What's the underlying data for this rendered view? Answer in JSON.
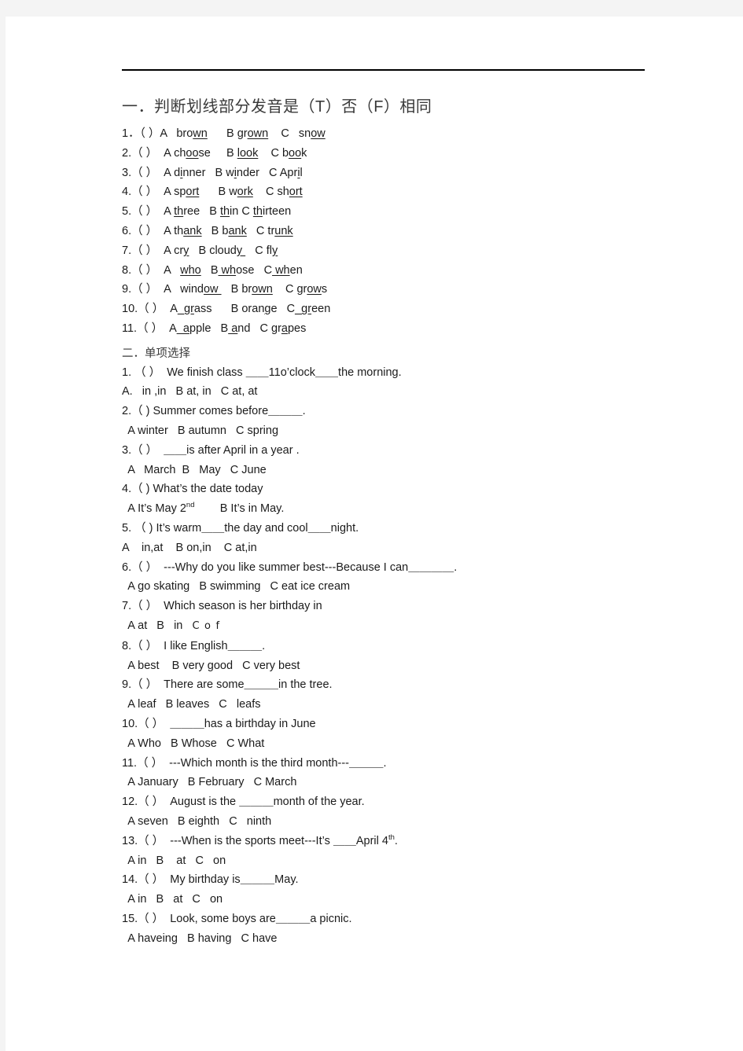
{
  "document": {
    "rule_present": true,
    "text_color": "#1b1b1b",
    "heading_color": "#3a3a3a",
    "page_background": "#ffffff",
    "canvas_background": "#f4f4f4"
  },
  "section_one": {
    "heading": "一．判断划线部分发音是（T）否（F）相同",
    "items": [
      {
        "num": "1．",
        "bracket": "（ ）",
        "parts": [
          {
            "pre": "A   bro",
            "u": "wn",
            "post": ""
          },
          {
            "pre": "      B gr",
            "u": "own",
            "post": ""
          },
          {
            "pre": "    C   sn",
            "u": "ow",
            "post": ""
          }
        ]
      },
      {
        "num": "2.",
        "bracket": "（ ）",
        "parts": [
          {
            "pre": "  A ch",
            "u": "oo",
            "post": "se"
          },
          {
            "pre": "     B ",
            "u": "look",
            "post": ""
          },
          {
            "pre": "    C b",
            "u": "oo",
            "post": "k"
          }
        ]
      },
      {
        "num": "3.",
        "bracket": "（ ）",
        "parts": [
          {
            "pre": "  A d",
            "u": "i",
            "post": "nner"
          },
          {
            "pre": "   B w",
            "u": "i",
            "post": "nder"
          },
          {
            "pre": "   C Apr",
            "u": "i",
            "post": "l"
          }
        ]
      },
      {
        "num": "4.",
        "bracket": "（ ）",
        "parts": [
          {
            "pre": "  A sp",
            "u": "ort",
            "post": ""
          },
          {
            "pre": "      B w",
            "u": "ork",
            "post": ""
          },
          {
            "pre": "    C sh",
            "u": "ort",
            "post": ""
          }
        ]
      },
      {
        "num": "5.",
        "bracket": "（ ）",
        "parts": [
          {
            "pre": "  A ",
            "u": "th",
            "post": "ree"
          },
          {
            "pre": "   B ",
            "u": "th",
            "post": "in"
          },
          {
            "pre": " C ",
            "u": "th",
            "post": "irteen"
          }
        ]
      },
      {
        "num": "6.",
        "bracket": "（ ）",
        "parts": [
          {
            "pre": "  A th",
            "u": "ank",
            "post": ""
          },
          {
            "pre": "   B b",
            "u": "ank",
            "post": ""
          },
          {
            "pre": "   C tr",
            "u": "unk",
            "post": ""
          }
        ]
      },
      {
        "num": "7.",
        "bracket": "（ ）",
        "parts": [
          {
            "pre": "  A cr",
            "u": "y",
            "post": ""
          },
          {
            "pre": "   B cloud",
            "u": "y ",
            "post": ""
          },
          {
            "pre": "   C fl",
            "u": "y",
            "post": ""
          }
        ]
      },
      {
        "num": "8.",
        "bracket": "（ ）",
        "parts": [
          {
            "pre": "  A   ",
            "u": "who",
            "post": ""
          },
          {
            "pre": "   B",
            "u": " wh",
            "post": "ose"
          },
          {
            "pre": "   C",
            "u": " wh",
            "post": "en"
          }
        ]
      },
      {
        "num": "9.",
        "bracket": "（ ）",
        "parts": [
          {
            "pre": "  A   wind",
            "u": "ow ",
            "post": ""
          },
          {
            "pre": "   B br",
            "u": "own",
            "post": ""
          },
          {
            "pre": "    C gr",
            "u": "ow",
            "post": "s"
          }
        ]
      },
      {
        "num": "10.",
        "bracket": "（ ）",
        "parts": [
          {
            "pre": "  A",
            "u": "_gr",
            "post": "ass"
          },
          {
            "pre": "      B oran",
            "u": "g",
            "post": "e"
          },
          {
            "pre": "   C",
            "u": "_gr",
            "post": "een"
          }
        ]
      },
      {
        "num": "11.",
        "bracket": "（ ）",
        "parts": [
          {
            "pre": "  A",
            "u": "_a",
            "post": "pple"
          },
          {
            "pre": "   B",
            "u": " a",
            "post": "nd"
          },
          {
            "pre": "   C gr",
            "u": "a",
            "post": "pes"
          }
        ]
      }
    ]
  },
  "section_two": {
    "heading": "二．单项选择",
    "questions": [
      {
        "stem": "1. （ ）  We finish class ＿＿11o’clock＿＿the morning.",
        "options": "A.   in ,in   B at, in   C at, at"
      },
      {
        "stem": "2.（ ) Summer comes before＿＿＿.",
        "options": " A winter   B autumn   C spring"
      },
      {
        "stem": "3.（ ）  ＿＿is after April in a year .",
        "options": " A   March  B   May   C June"
      },
      {
        "stem": "4.（ ) What’s the date today",
        "options": " A It’s May 2",
        "options_sup": "nd",
        "options_tail": "        B It’s in May."
      },
      {
        "stem": "5. （ ) It’s warm＿＿the day and cool＿＿night.",
        "options": "A    in,at    B on,in    C at,in"
      },
      {
        "stem": "6.（ ）  ---Why do you like summer best---Because I can＿＿＿＿.",
        "options": " A go skating   B swimming   C eat ice cream"
      },
      {
        "stem": "7.（ ）  Which season is her birthday in",
        "options": " A at   B   in   ",
        "options_odd": "C o f"
      },
      {
        "stem": "8.（ ）  I like English＿＿＿.",
        "options": " A best    B very good   C very best"
      },
      {
        "stem": "9.（ ）  There are some＿＿＿in the tree.",
        "options": " A leaf   B leaves   C   leafs"
      },
      {
        "stem": "10.（ ）  ＿＿＿has a birthday in June",
        "options": " A Who   B Whose   C What"
      },
      {
        "stem": "11.（ ）  ---Which month is the third month---＿＿＿.",
        "options": " A January   B February   C March"
      },
      {
        "stem": "12.（ ）  August is the ＿＿＿month of the year.",
        "options": " A seven   B eighth   C   ninth"
      },
      {
        "stem": "13.（ ）  ---When is the sports meet---It’s ＿＿April 4",
        "stem_sup": "th",
        "stem_tail": ".",
        "options": " A in   B    at   C   on"
      },
      {
        "stem": "14.（ ）  My birthday is＿＿＿May.",
        "options": " A in   B   at   C   on"
      },
      {
        "stem": "15.（ ）  Look, some boys are＿＿＿a picnic.",
        "options": " A haveing   B having   C have"
      }
    ]
  }
}
